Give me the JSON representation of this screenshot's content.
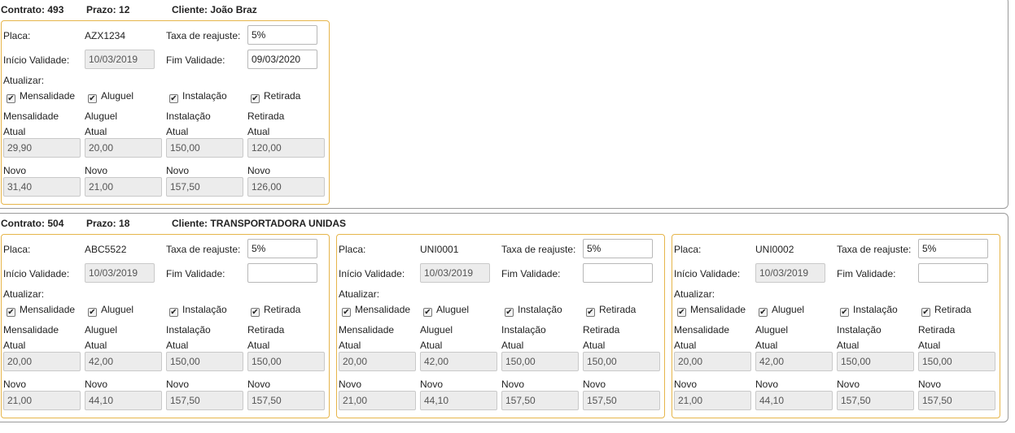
{
  "labels": {
    "contrato": "Contrato:",
    "prazo": "Prazo:",
    "cliente": "Cliente:",
    "placa": "Placa:",
    "taxa": "Taxa de reajuste:",
    "inicio": "Início Validade:",
    "fim": "Fim Validade:",
    "atualizar": "Atualizar:",
    "mensalidade": "Mensalidade",
    "aluguel": "Aluguel",
    "instalacao": "Instalação",
    "retirada": "Retirada",
    "atual": "Atual",
    "novo": "Novo",
    "check_glyph": "✔"
  },
  "contracts": [
    {
      "numero": "493",
      "prazo": "12",
      "cliente": "João Braz",
      "vehicles": [
        {
          "placa": "AZX1234",
          "taxa": "5%",
          "inicio": "10/03/2019",
          "fim": "09/03/2020",
          "checks": {
            "mensalidade": true,
            "aluguel": true,
            "instalacao": true,
            "retirada": true
          },
          "atual": [
            "29,90",
            "20,00",
            "150,00",
            "120,00"
          ],
          "novo": [
            "31,40",
            "21,00",
            "157,50",
            "126,00"
          ]
        }
      ]
    },
    {
      "numero": "504",
      "prazo": "18",
      "cliente": "TRANSPORTADORA UNIDAS",
      "vehicles": [
        {
          "placa": "ABC5522",
          "taxa": "5%",
          "inicio": "10/03/2019",
          "fim": "",
          "checks": {
            "mensalidade": true,
            "aluguel": true,
            "instalacao": true,
            "retirada": true
          },
          "atual": [
            "20,00",
            "42,00",
            "150,00",
            "150,00"
          ],
          "novo": [
            "21,00",
            "44,10",
            "157,50",
            "157,50"
          ]
        },
        {
          "placa": "UNI0001",
          "taxa": "5%",
          "inicio": "10/03/2019",
          "fim": "",
          "checks": {
            "mensalidade": true,
            "aluguel": true,
            "instalacao": true,
            "retirada": true
          },
          "atual": [
            "20,00",
            "42,00",
            "150,00",
            "150,00"
          ],
          "novo": [
            "21,00",
            "44,10",
            "157,50",
            "157,50"
          ]
        },
        {
          "placa": "UNI0002",
          "taxa": "5%",
          "inicio": "10/03/2019",
          "fim": "",
          "checks": {
            "mensalidade": true,
            "aluguel": true,
            "instalacao": true,
            "retirada": true
          },
          "atual": [
            "20,00",
            "42,00",
            "150,00",
            "150,00"
          ],
          "novo": [
            "21,00",
            "44,10",
            "157,50",
            "157,50"
          ]
        }
      ]
    }
  ]
}
